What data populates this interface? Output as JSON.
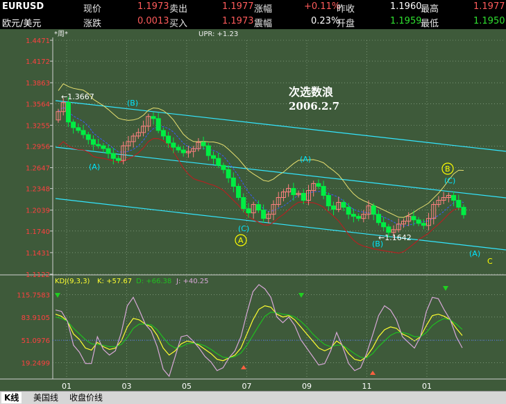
{
  "quote": {
    "symbol": "EURUSD",
    "name": "欧元/美元",
    "row1": [
      {
        "label": "现价",
        "value": "1.1973"
      },
      {
        "label": "卖出",
        "value": "1.1977"
      },
      {
        "label": "涨幅",
        "value": "+0.11%"
      },
      {
        "label": "昨收",
        "value": "1.1960"
      },
      {
        "label": "最高",
        "value": "1.1977"
      }
    ],
    "row2": [
      {
        "label": "涨跌",
        "value": "0.0013"
      },
      {
        "label": "买入",
        "value": "1.1973"
      },
      {
        "label": "震幅",
        "value": "0.23%"
      },
      {
        "label": "开盘",
        "value": "1.1959"
      },
      {
        "label": "最低",
        "value": "1.1950"
      }
    ]
  },
  "main_header": {
    "period": "*周*",
    "upr": "UPR: +1.23"
  },
  "annotation": {
    "line1": "次选数浪",
    "line2": "2006.2.7"
  },
  "waves": [
    {
      "text": "←1.3667",
      "color": "#ffffff"
    },
    {
      "text": "(B)",
      "color": "#00e5ff"
    },
    {
      "text": "(A)",
      "color": "#00e5ff"
    },
    {
      "text": "(C)",
      "color": "#00e5ff"
    },
    {
      "text": "A",
      "color": "#ffff00"
    },
    {
      "text": "(A)",
      "color": "#00e5ff"
    },
    {
      "text": "B",
      "color": "#ffff00"
    },
    {
      "text": "(C)",
      "color": "#00e5ff"
    },
    {
      "text": "←1.1642",
      "color": "#ffffff"
    },
    {
      "text": "(B)",
      "color": "#00e5ff"
    },
    {
      "text": "(A)",
      "color": "#00e5ff"
    },
    {
      "text": "C",
      "color": "#ffff00"
    }
  ],
  "kdj_header": {
    "name": "KDJ(9,3,3)",
    "k": "K: +57.67",
    "d": "D: +66.38",
    "j": "J: +40.25"
  },
  "tabs": [
    "K线",
    "美国线",
    "收盘价线"
  ],
  "colors": {
    "bg": "#3e5a3a",
    "up": "#ff8080",
    "down": "#00ee44",
    "grid": "#9fb89a",
    "channel": "#33e6ff",
    "upper": "#e8e070",
    "mid": "#3a5cff",
    "lower": "#b22222",
    "k": "#ffff30",
    "d": "#20c020",
    "j": "#d8a8d8"
  },
  "chart_data": [
    {
      "type": "candlestick",
      "title": "EURUSD",
      "x_ticks": [
        "01",
        "03",
        "05",
        "07",
        "09",
        "11",
        "01"
      ],
      "ylim": [
        1.1122,
        1.4471
      ],
      "y_ticks": [
        1.4471,
        1.4172,
        1.3863,
        1.3564,
        1.3255,
        1.2956,
        1.2647,
        1.2348,
        1.2039,
        1.174,
        1.1431,
        1.1122
      ],
      "series": [
        {
          "name": "close",
          "values": [
            1.345,
            1.358,
            1.33,
            1.322,
            1.318,
            1.312,
            1.305,
            1.298,
            1.296,
            1.292,
            1.285,
            1.278,
            1.275,
            1.296,
            1.302,
            1.31,
            1.315,
            1.324,
            1.338,
            1.335,
            1.318,
            1.31,
            1.3,
            1.294,
            1.29,
            1.286,
            1.288,
            1.292,
            1.301,
            1.296,
            1.282,
            1.278,
            1.268,
            1.262,
            1.25,
            1.238,
            1.222,
            1.206,
            1.2,
            1.212,
            1.204,
            1.192,
            1.198,
            1.212,
            1.222,
            1.23,
            1.235,
            1.226,
            1.228,
            1.218,
            1.232,
            1.242,
            1.238,
            1.225,
            1.21,
            1.205,
            1.215,
            1.208,
            1.198,
            1.195,
            1.192,
            1.198,
            1.21,
            1.198,
            1.186,
            1.18,
            1.172,
            1.176,
            1.184,
            1.188,
            1.195,
            1.19,
            1.185,
            1.182,
            1.192,
            1.212,
            1.218,
            1.222,
            1.225,
            1.218,
            1.208,
            1.1973
          ]
        }
      ],
      "annotations": [
        {
          "text": "1.3667",
          "x_index": 1
        },
        {
          "text": "1.1642",
          "x_index": 66
        }
      ]
    },
    {
      "type": "line",
      "title": "KDJ(9,3,3)",
      "ylim": [
        0,
        130
      ],
      "y_ticks": [
        115.7583,
        83.9105,
        51.0976,
        19.2499
      ],
      "series": [
        {
          "name": "K",
          "values": [
            88,
            85,
            78,
            60,
            52,
            40,
            37,
            48,
            42,
            38,
            40,
            50,
            70,
            82,
            80,
            74,
            70,
            58,
            40,
            30,
            36,
            46,
            50,
            48,
            44,
            38,
            32,
            24,
            22,
            26,
            30,
            40,
            60,
            80,
            95,
            100,
            98,
            88,
            84,
            86,
            80,
            70,
            60,
            50,
            40,
            36,
            40,
            50,
            44,
            32,
            24,
            22,
            28,
            40,
            56,
            66,
            70,
            68,
            60,
            56,
            50,
            56,
            72,
            86,
            88,
            85,
            80,
            68,
            57.67
          ]
        },
        {
          "name": "D",
          "values": [
            84,
            82,
            78,
            68,
            60,
            52,
            46,
            45,
            44,
            42,
            42,
            45,
            55,
            68,
            74,
            74,
            73,
            66,
            55,
            45,
            40,
            42,
            46,
            47,
            46,
            43,
            38,
            32,
            27,
            26,
            28,
            33,
            44,
            58,
            72,
            85,
            91,
            90,
            88,
            87,
            84,
            78,
            70,
            60,
            52,
            45,
            42,
            44,
            44,
            38,
            32,
            27,
            26,
            32,
            42,
            50,
            58,
            62,
            62,
            60,
            56,
            56,
            62,
            72,
            78,
            82,
            80,
            74,
            66.38
          ]
        },
        {
          "name": "J",
          "values": [
            94,
            92,
            78,
            44,
            34,
            18,
            18,
            56,
            38,
            30,
            36,
            62,
            100,
            112,
            94,
            74,
            64,
            42,
            10,
            0,
            28,
            56,
            58,
            50,
            40,
            28,
            20,
            8,
            12,
            26,
            36,
            56,
            90,
            120,
            130,
            124,
            112,
            84,
            76,
            84,
            72,
            52,
            40,
            28,
            16,
            18,
            36,
            62,
            42,
            18,
            8,
            12,
            32,
            58,
            86,
            100,
            94,
            80,
            56,
            48,
            40,
            56,
            92,
            112,
            110,
            94,
            80,
            56,
            40.25
          ]
        }
      ]
    }
  ]
}
